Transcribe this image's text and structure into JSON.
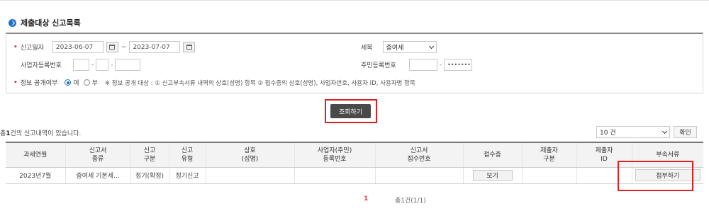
{
  "section": {
    "title": "제출대상 신고목록"
  },
  "search": {
    "date_label": "신고일자",
    "date_from": "2023-06-07",
    "date_to": "2023-07-07",
    "tilde": "~",
    "tax_label": "세목",
    "tax_selected": "증여세",
    "bizno_label": "사업자등록번호",
    "rrn_label": "주민등록번호",
    "rrn_masked": "•••••••",
    "disclosure_label": "정보 공개여부",
    "yes_label": "여",
    "no_label": "부",
    "note": "※ 정보 공개 대상 : ① 신고부속서류 내역의 상호(성명) 항목 ② 접수증의 상호(성명), 사업자번호, 사용자 ID, 사용자명 항목",
    "search_button": "조회하기"
  },
  "result": {
    "count_prefix": "총",
    "count": "1",
    "count_suffix": "건의 신고내역이 있습니다.",
    "page_size": "10 건",
    "ok_button": "확인"
  },
  "table": {
    "headers": [
      [
        "과세연월",
        ""
      ],
      [
        "신고서",
        "종류"
      ],
      [
        "신고",
        "구분"
      ],
      [
        "신고",
        "유형"
      ],
      [
        "상호",
        "(성명)"
      ],
      [
        "사업자(주민)",
        "등록번호"
      ],
      [
        "신고서",
        "접수번호"
      ],
      [
        "접수증",
        ""
      ],
      [
        "제출자",
        "구분"
      ],
      [
        "제출자",
        "ID"
      ],
      [
        "부속서류",
        ""
      ]
    ],
    "row": {
      "period": "2023년7월",
      "form": "증여세 기본세...",
      "category": "정기(확정)",
      "type": "정기신고",
      "name": "",
      "regno": "",
      "receipt_no": "",
      "receipt_button": "보기",
      "submitter_type": "",
      "submitter_id": "",
      "attach_button": "첨부하기"
    }
  },
  "pager": {
    "current": "1",
    "total": "총1건(1/1)"
  },
  "colors": {
    "accent": "#1a73c9",
    "highlight": "#e02020",
    "required": "#e0393e"
  }
}
